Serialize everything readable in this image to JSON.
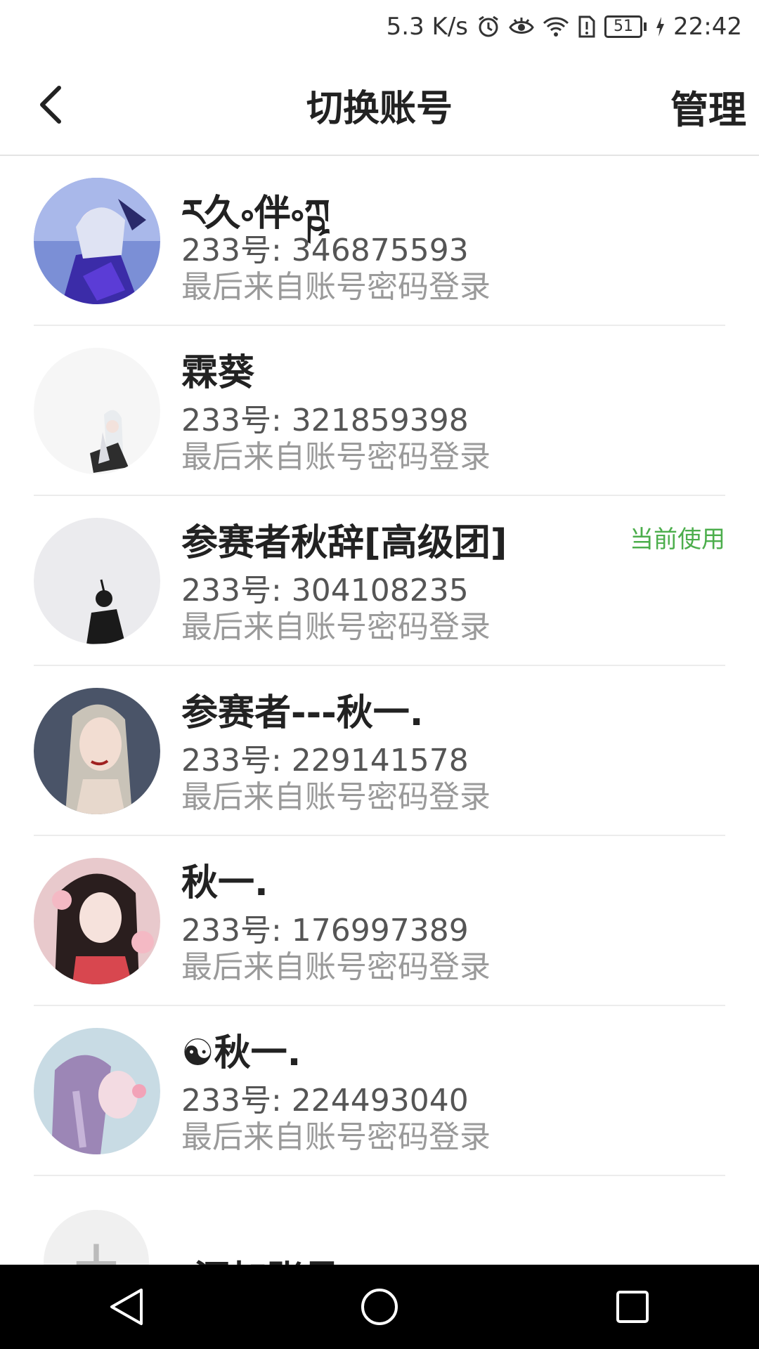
{
  "status_bar": {
    "network_speed": "5.3 K/s",
    "battery_level": "51",
    "time": "22:42",
    "icons": [
      "alarm-icon",
      "eye-icon",
      "wifi-icon",
      "sim-alert-icon",
      "battery-icon",
      "charging-icon"
    ]
  },
  "header": {
    "title": "切换账号",
    "manage_label": "管理",
    "back_icon": "chevron-left-icon"
  },
  "accounts": [
    {
      "name": "ར久༚伴༚ཀྵ",
      "id_text": "233号: 346875593",
      "login_text": "最后来自账号密码登录",
      "current": ""
    },
    {
      "name": "霖葵",
      "id_text": "233号: 321859398",
      "login_text": "最后来自账号密码登录",
      "current": ""
    },
    {
      "name": "参赛者秋辞[高级团]",
      "id_text": "233号: 304108235",
      "login_text": "最后来自账号密码登录",
      "current": "当前使用"
    },
    {
      "name": "参赛者---秋一.",
      "id_text": "233号: 229141578",
      "login_text": "最后来自账号密码登录",
      "current": ""
    },
    {
      "name": "秋一.",
      "id_text": "233号: 176997389",
      "login_text": "最后来自账号密码登录",
      "current": ""
    },
    {
      "name": "☯秋一.",
      "id_text": "233号: 224493040",
      "login_text": "最后来自账号密码登录",
      "current": ""
    }
  ],
  "add_account": {
    "plus": "+",
    "label": "添加账号"
  },
  "colors": {
    "current_badge": "#4cae4c",
    "divider": "#ececec"
  },
  "nav_bar": {
    "icons": [
      "back-triangle-icon",
      "home-circle-icon",
      "recents-square-icon"
    ]
  }
}
